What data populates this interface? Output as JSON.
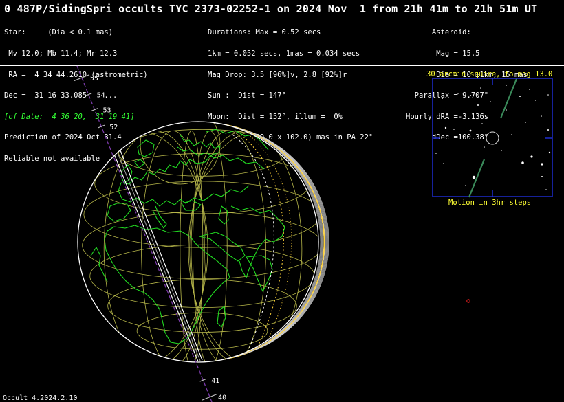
{
  "title": "0 487P/SidingSpri occults TYC 2373-02252-1 on 2024 Nov  1 from 21h 41m to 21h 51m UT",
  "star": [
    "Star:     (Dia < 0.1 mas)",
    " Mv 12.0; Mb 11.4; Mr 12.3",
    " RA =  4 34 44.2610 (astrometric)",
    "Dec =  31 16 33.085    ...",
    "[of Date:  4 36 20,  31 19 41]",
    "Prediction of 2024 Oct 31.4",
    "Reliable not available"
  ],
  "event": [
    "Durations: Max = 0.52 secs",
    "1km = 0.052 secs, 1mas = 0.034 secs",
    "Mag Drop: 3.5 [96%]v, 2.8 [92%]r",
    "Sun :  Dist = 147°",
    "Moon:  Dist = 152°, illum =  0%",
    "1σ Err: ±(129.0 x 102.0) mas in PA 22°"
  ],
  "asteroid": [
    "      Asteroid:",
    "       Mag = 15.5",
    "       Dia = 10 ±1km, 15 mas",
    "  Parallax = 9.707\"",
    "Hourly dRA =-3.136s",
    "      dDec =100.38\""
  ],
  "starchart": {
    "caption_top": "30 arcmin square, to mag 13.0",
    "caption_bottom": "Motion in 3hr steps"
  },
  "path_ticks": [
    {
      "label": "55",
      "frac": 0.035
    },
    {
      "label": "54",
      "frac": 0.085
    },
    {
      "label": "53",
      "frac": 0.13
    },
    {
      "label": "52",
      "frac": 0.18
    },
    {
      "label": "41",
      "frac": 0.935
    },
    {
      "label": "40",
      "frac": 0.985
    }
  ],
  "version": "Occult 4.2024.2.10",
  "colors": {
    "coast": "#22dd22",
    "grid": "#b8b84a",
    "path": "#ffffff",
    "track": "#7a3aa8",
    "terminator": "#ffd23a",
    "chart_frame": "#2233ee",
    "caption": "#ffff33"
  }
}
